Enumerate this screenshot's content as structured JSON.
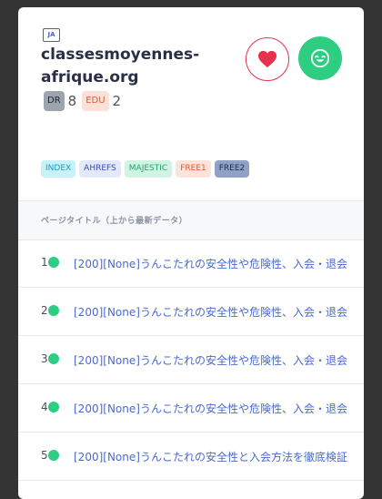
{
  "site": {
    "lang": "JA",
    "domain": "classesmoyennes-afrique.org",
    "dr_label": "DR",
    "dr_value": "8",
    "edu_label": "EDU",
    "edu_value": "2"
  },
  "actions": {
    "favorite_icon": "heart-icon",
    "status_icon": "smile-icon",
    "colors": {
      "heart": "#e8304f",
      "smile": "#2dcd82"
    }
  },
  "tags": [
    "INDEX",
    "AHREFS",
    "MAJESTIC",
    "FREE1",
    "FREE2"
  ],
  "table": {
    "header": "ページタイトル（上から最新データ）",
    "rows": [
      {
        "num": "1",
        "title": "[200][None]うんこたれの安全性や危険性、入会・退会"
      },
      {
        "num": "2",
        "title": "[200][None]うんこたれの安全性や危険性、入会・退会"
      },
      {
        "num": "3",
        "title": "[200][None]うんこたれの安全性や危険性、入会・退会"
      },
      {
        "num": "4",
        "title": "[200][None]うんこたれの安全性や危険性、入会・退会"
      },
      {
        "num": "5",
        "title": "[200][None]うんこたれの安全性と入会方法を徹底検証"
      }
    ]
  }
}
